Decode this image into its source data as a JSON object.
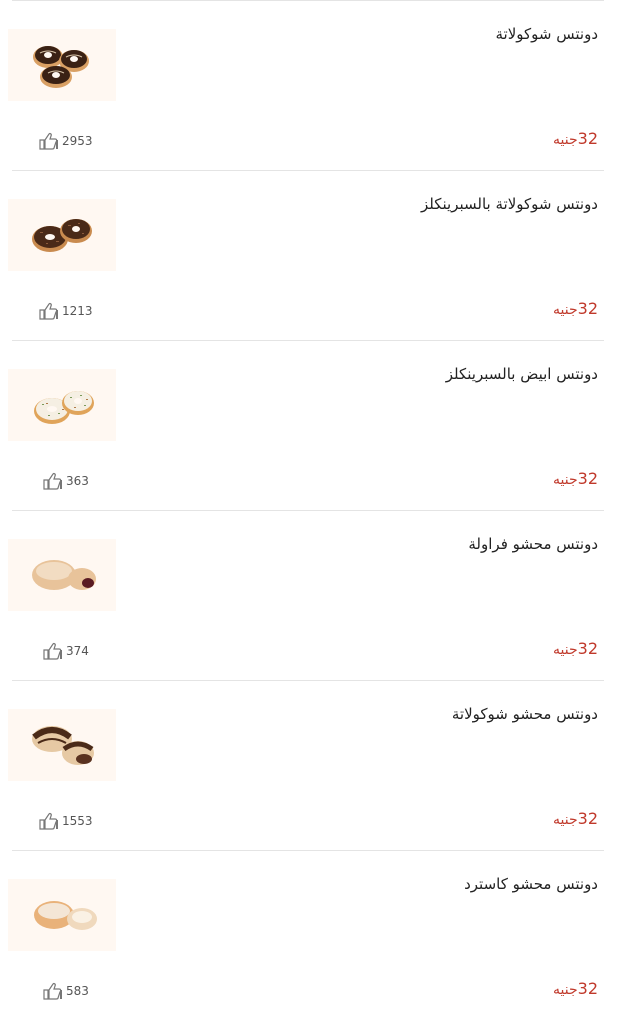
{
  "currency": "جنيه",
  "items": [
    {
      "name": "دونتس شوكولاتة",
      "price": "32",
      "likes": "2953",
      "image": "chocolate-glazed-donuts"
    },
    {
      "name": "دونتس شوكولاتة بالسبرينكلز",
      "price": "32",
      "likes": "1213",
      "image": "chocolate-sprinkles-donuts"
    },
    {
      "name": "دونتس ابيض بالسبرينكلز",
      "price": "32",
      "likes": "363",
      "image": "white-sprinkles-donuts"
    },
    {
      "name": "دونتس محشو فراولة",
      "price": "32",
      "likes": "374",
      "image": "strawberry-filled-donuts"
    },
    {
      "name": "دونتس محشو شوكولاتة",
      "price": "32",
      "likes": "1553",
      "image": "chocolate-filled-donuts"
    },
    {
      "name": "دونتس محشو كاسترد",
      "price": "32",
      "likes": "583",
      "image": "custard-filled-donuts"
    }
  ],
  "colors": {
    "price": "#c0392b",
    "divider": "#e4e4e4",
    "thumb_bg": "#fff8f2"
  }
}
